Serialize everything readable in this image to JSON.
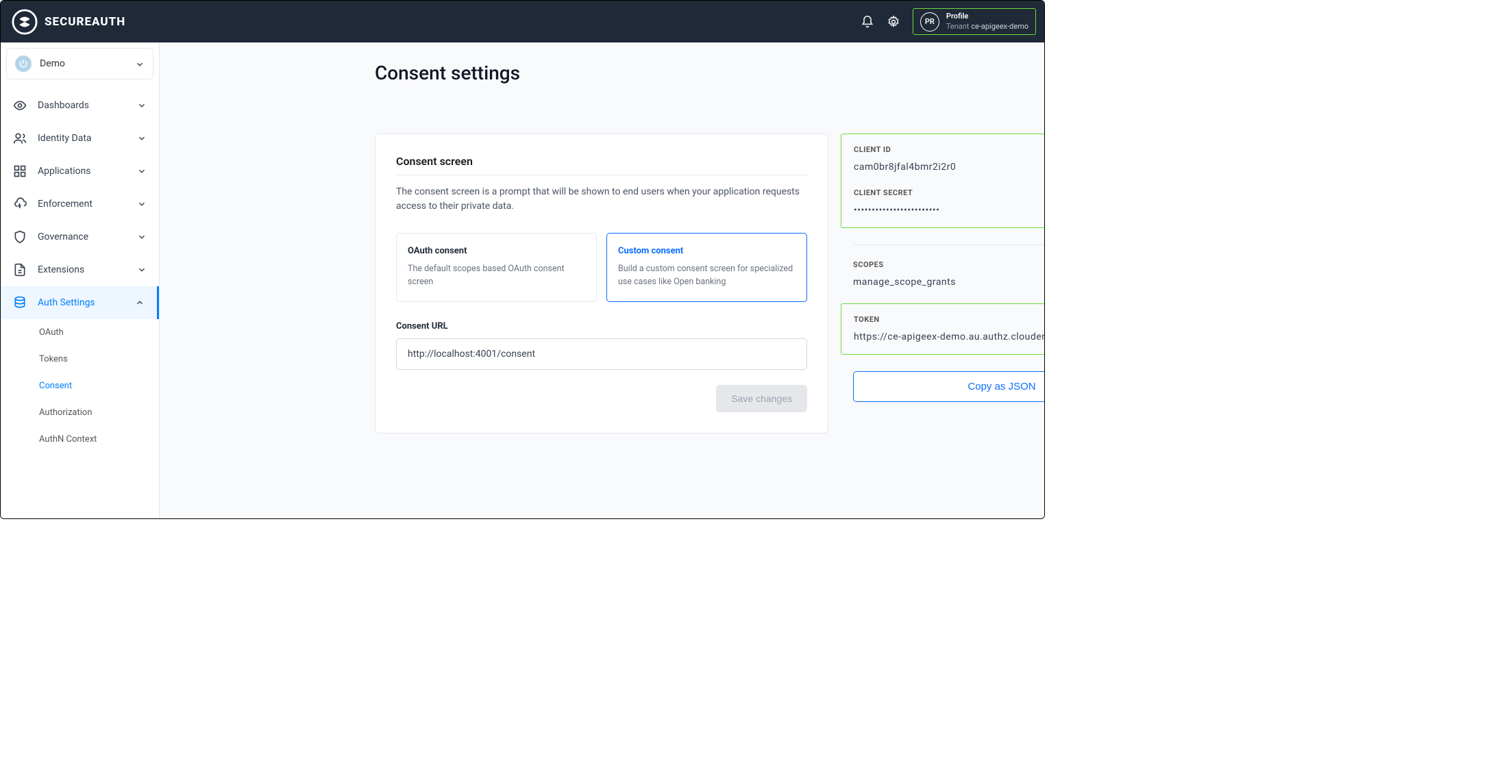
{
  "brand": {
    "name": "SECUREAUTH"
  },
  "profile": {
    "label": "Profile",
    "tenant_label": "Tenant",
    "tenant_name": "ce-apigeex-demo",
    "avatar": "PR"
  },
  "workspace": {
    "name": "Demo"
  },
  "nav": {
    "items": [
      {
        "label": "Dashboards"
      },
      {
        "label": "Identity Data"
      },
      {
        "label": "Applications"
      },
      {
        "label": "Enforcement"
      },
      {
        "label": "Governance"
      },
      {
        "label": "Extensions"
      },
      {
        "label": "Auth Settings"
      }
    ],
    "sub": [
      {
        "label": "OAuth"
      },
      {
        "label": "Tokens"
      },
      {
        "label": "Consent"
      },
      {
        "label": "Authorization"
      },
      {
        "label": "AuthN Context"
      }
    ]
  },
  "page": {
    "title": "Consent settings"
  },
  "consent": {
    "section_title": "Consent screen",
    "section_desc": "The consent screen is a prompt that will be shown to end users when your application requests access to their private data.",
    "options": [
      {
        "title": "OAuth consent",
        "desc": "The default scopes based OAuth consent screen"
      },
      {
        "title": "Custom consent",
        "desc": "Build a custom consent screen for specialized use cases like Open banking"
      }
    ],
    "url_label": "Consent URL",
    "url_value": "http://localhost:4001/consent",
    "save_label": "Save changes"
  },
  "side": {
    "client_id_label": "CLIENT ID",
    "client_id_value": "cam0br8jfal4bmr2i2r0",
    "client_secret_label": "CLIENT SECRET",
    "client_secret_value": "••••••••••••••••••••••••",
    "scopes_label": "SCOPES",
    "scopes_value": "manage_scope_grants",
    "token_label": "TOKEN",
    "token_value": "https://ce-apigeex-demo.au.authz.cloudentity.io/ce-apigee...",
    "copy_json_label": "Copy as JSON"
  }
}
